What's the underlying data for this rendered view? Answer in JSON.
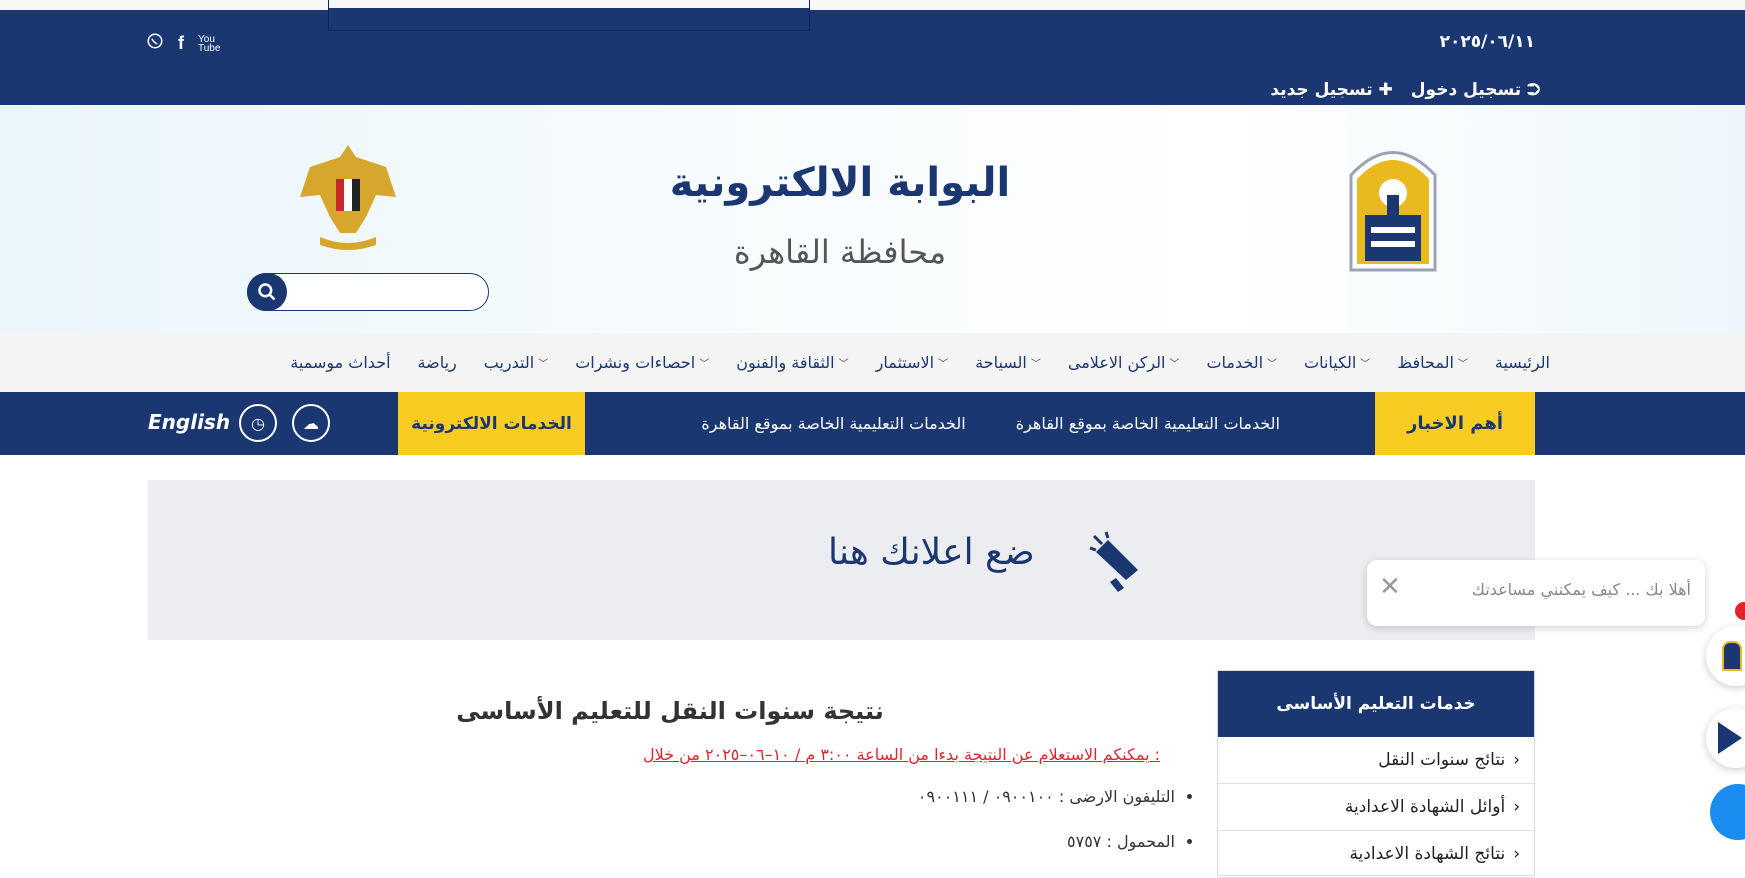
{
  "topbar": {
    "date": "٢٠٢٥/٠٦/١١",
    "login_label": "تسجيل دخول",
    "register_label": "تسجيل جديد",
    "social_icons": [
      "whatsapp-icon",
      "facebook-icon",
      "youtube-icon"
    ]
  },
  "header": {
    "title": "البوابة الالكترونية",
    "subtitle": "محافظة القاهرة",
    "search_placeholder": ""
  },
  "nav": {
    "items": [
      {
        "label": "الرئيسية",
        "dropdown": false
      },
      {
        "label": "المحافظ",
        "dropdown": true
      },
      {
        "label": "الكيانات",
        "dropdown": true
      },
      {
        "label": "الخدمات",
        "dropdown": true
      },
      {
        "label": "الركن الاعلامى",
        "dropdown": true
      },
      {
        "label": "السياحة",
        "dropdown": true
      },
      {
        "label": "الاستثمار",
        "dropdown": true
      },
      {
        "label": "الثقافة والفنون",
        "dropdown": true
      },
      {
        "label": "احصاءات ونشرات",
        "dropdown": true
      },
      {
        "label": "التدريب",
        "dropdown": true
      },
      {
        "label": "رياضة",
        "dropdown": false
      },
      {
        "label": "أحداث موسمية",
        "dropdown": false
      }
    ]
  },
  "ticker": {
    "head": "أهم الاخبار",
    "items": [
      "الخدمات التعليمية الخاصة بموقع القاهرة",
      "الخدمات التعليمية الخاصة بموقع القاهرة"
    ],
    "eservices": "الخدمات الالكترونية",
    "english": "English"
  },
  "ad": {
    "text": "ضع اعلانك هنا"
  },
  "chat": {
    "message": "أهلا بك ... كيف يمكنني مساعدتك"
  },
  "sidebar": {
    "title": "خدمات التعليم الأساسى",
    "items": [
      "نتائج سنوات النقل",
      "أوائل الشهادة الاعدادية",
      "نتائج الشهادة الاعدادية"
    ]
  },
  "content": {
    "title": "نتيجة سنوات النقل للتعليم الأساسى",
    "notice": "يمكنكم الاستعلام عن النتيجة بدءا من الساعة ٣:٠٠ م / ١٠–٠٦–٢٠٢٥ من خلال :",
    "bullets": [
      "التليفون الارضى : ٠٩٠٠١٠٠ / ٠٩٠٠١١١",
      "المحمول : ٥٧٥٧"
    ]
  },
  "colors": {
    "navy": "#1b3771",
    "yellow": "#f8cc21",
    "red": "#e0252a"
  }
}
